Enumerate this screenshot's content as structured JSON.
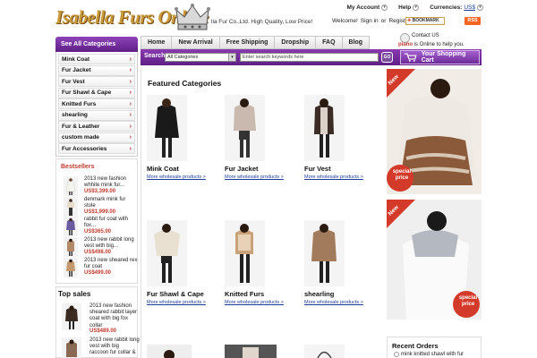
{
  "header": {
    "logo_text": "Isabella Furs Online",
    "tagline": "lla Fur Co.,Ltd. High Quality, Low Price!",
    "menus": [
      {
        "label": "My Account"
      },
      {
        "label": "Help"
      },
      {
        "label": "Currencies:",
        "value": "US$"
      }
    ],
    "welcome": "Welcome!",
    "sign_in": "Sign in",
    "or": "or",
    "register": "Register",
    "bookmark": "BOOKMARK",
    "rss": "RSS"
  },
  "nav": {
    "tabs": [
      "Home",
      "New Arrival",
      "Free Shipping",
      "Dropship",
      "FAQ",
      "Blog"
    ]
  },
  "contact": {
    "label": "Contact US",
    "who": "piano",
    "status": " is Online to help you."
  },
  "search": {
    "label": "Search",
    "category": "All Categories",
    "placeholder": "Enter search keywords here",
    "go": "GO",
    "cart": "Your Shopping Cart"
  },
  "sidebar": {
    "title": "See All Categories",
    "items": [
      "Mink Coat",
      "Fur Jacket",
      "Fur Vest",
      "Fur Shawl & Cape",
      "Knitted Furs",
      "shearling",
      "Fur & Leather",
      "custom made",
      "Fur Accessories"
    ],
    "arrow": "›"
  },
  "bestsellers": {
    "title": "Bestsellers",
    "items": [
      {
        "name": "2013 new fashion whhite mink fur...",
        "price": "US$3,399.00"
      },
      {
        "name": "denmark mink fur stole",
        "price": "US$1,999.00"
      },
      {
        "name": "rabbit fur coat with fox...",
        "price": "US$365.00"
      },
      {
        "name": "2013 new rabbit long vest with big...",
        "price": "US$498.00"
      },
      {
        "name": "2013 new sheared rex fur coat",
        "price": "US$499.00"
      }
    ]
  },
  "topsales": {
    "title": "Top sales",
    "items": [
      {
        "name": "2013 new fashion sheared rabbit layer coat with big fox collar",
        "price": "US$489.00"
      },
      {
        "name": "2013 new rabbit long vest with big raccoon fur collar &",
        "price": ""
      }
    ]
  },
  "featured": {
    "title": "Featured Categories",
    "more_label": "More wholesale products >",
    "categories": [
      "Mink Coat",
      "Fur Jacket",
      "Fur Vest",
      "Fur Shawl & Cape",
      "Knitted Furs",
      "shearling"
    ]
  },
  "banners": {
    "badge_new": "New",
    "badge_special": "special price"
  },
  "recent": {
    "title": "Recent Orders",
    "item": "mink knitted shawl with fur"
  },
  "colors": {
    "accent_purple": "#6d2b97",
    "price_red": "#c0392b",
    "link_blue": "#1a3d9c",
    "logo_gold": "#c89a3c"
  }
}
